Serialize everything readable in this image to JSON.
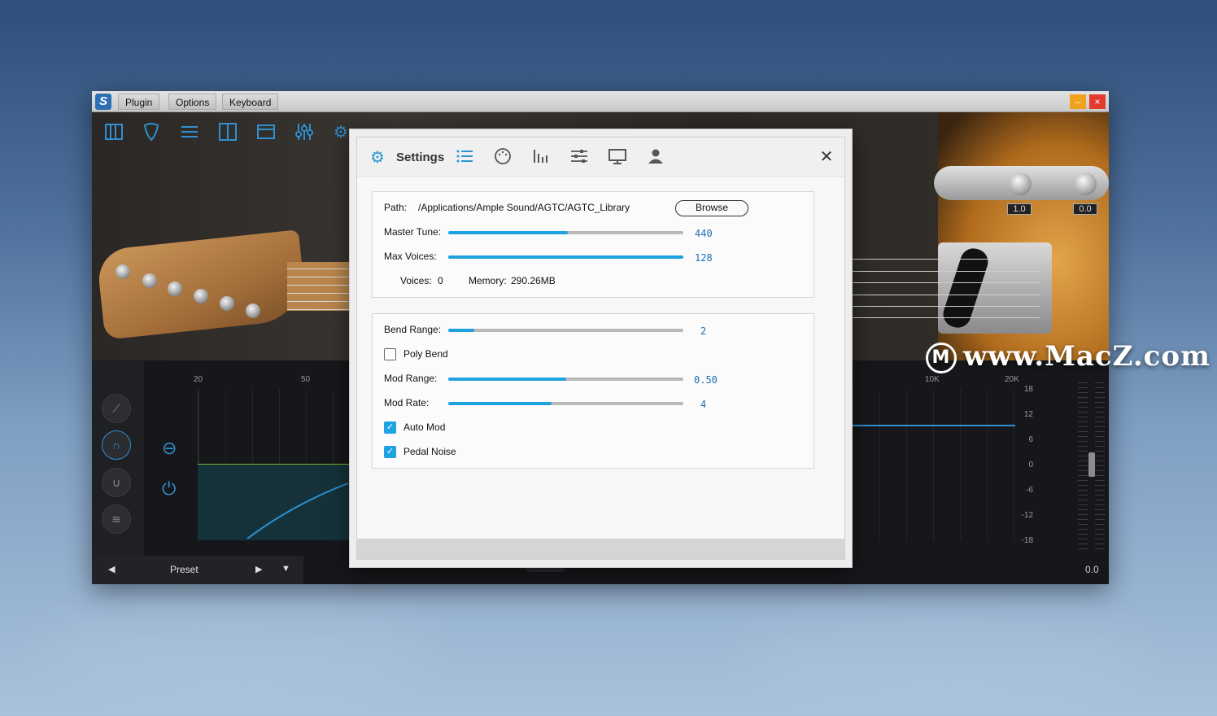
{
  "window": {
    "menu": [
      "Plugin",
      "Options",
      "Keyboard"
    ],
    "minimize_glyph": "–",
    "close_glyph": "×"
  },
  "toolbar": {
    "icons": [
      "piano-icon",
      "pick-icon",
      "sliders-icon",
      "mixer-icon",
      "browser-icon",
      "equalizer-icon",
      "gear-icon"
    ]
  },
  "guitar": {
    "knob_values": [
      "1.0",
      "0.0"
    ]
  },
  "eq": {
    "freq_left": [
      "20",
      "50"
    ],
    "freq_right": [
      "10K",
      "20K"
    ],
    "db_scale": [
      "18",
      "12",
      "6",
      "0",
      "-6",
      "-12",
      "-18"
    ],
    "output_value": "0.0"
  },
  "preset": {
    "label": "Preset"
  },
  "watermark": {
    "text": "www.MacZ.com",
    "logo_letter": "M"
  },
  "settings": {
    "title": "Settings",
    "tab_icons": [
      "list-icon",
      "palette-icon",
      "fader-icon",
      "sliders-icon",
      "monitor-icon",
      "user-icon"
    ],
    "path_label": "Path:",
    "path_value": "/Applications/Ample Sound/AGTC/AGTC_Library",
    "browse_label": "Browse",
    "master_tune": {
      "label": "Master Tune:",
      "value": "440",
      "fill_percent": 51
    },
    "max_voices": {
      "label": "Max Voices:",
      "value": "128",
      "fill_percent": 100
    },
    "voices_label": "Voices:",
    "voices_value": "0",
    "memory_label": "Memory:",
    "memory_value": "290.26MB",
    "bend_range": {
      "label": "Bend Range:",
      "value": "2",
      "fill_percent": 11
    },
    "poly_bend": {
      "label": "Poly Bend",
      "checked": false
    },
    "mod_range": {
      "label": "Mod Range:",
      "value": "0.50",
      "fill_percent": 50
    },
    "mod_rate": {
      "label": "Mod Rate:",
      "value": "4",
      "fill_percent": 44
    },
    "auto_mod": {
      "label": "Auto Mod",
      "checked": true
    },
    "pedal_noise": {
      "label": "Pedal Noise",
      "checked": true
    },
    "accent_color": "#1fa3e0"
  }
}
